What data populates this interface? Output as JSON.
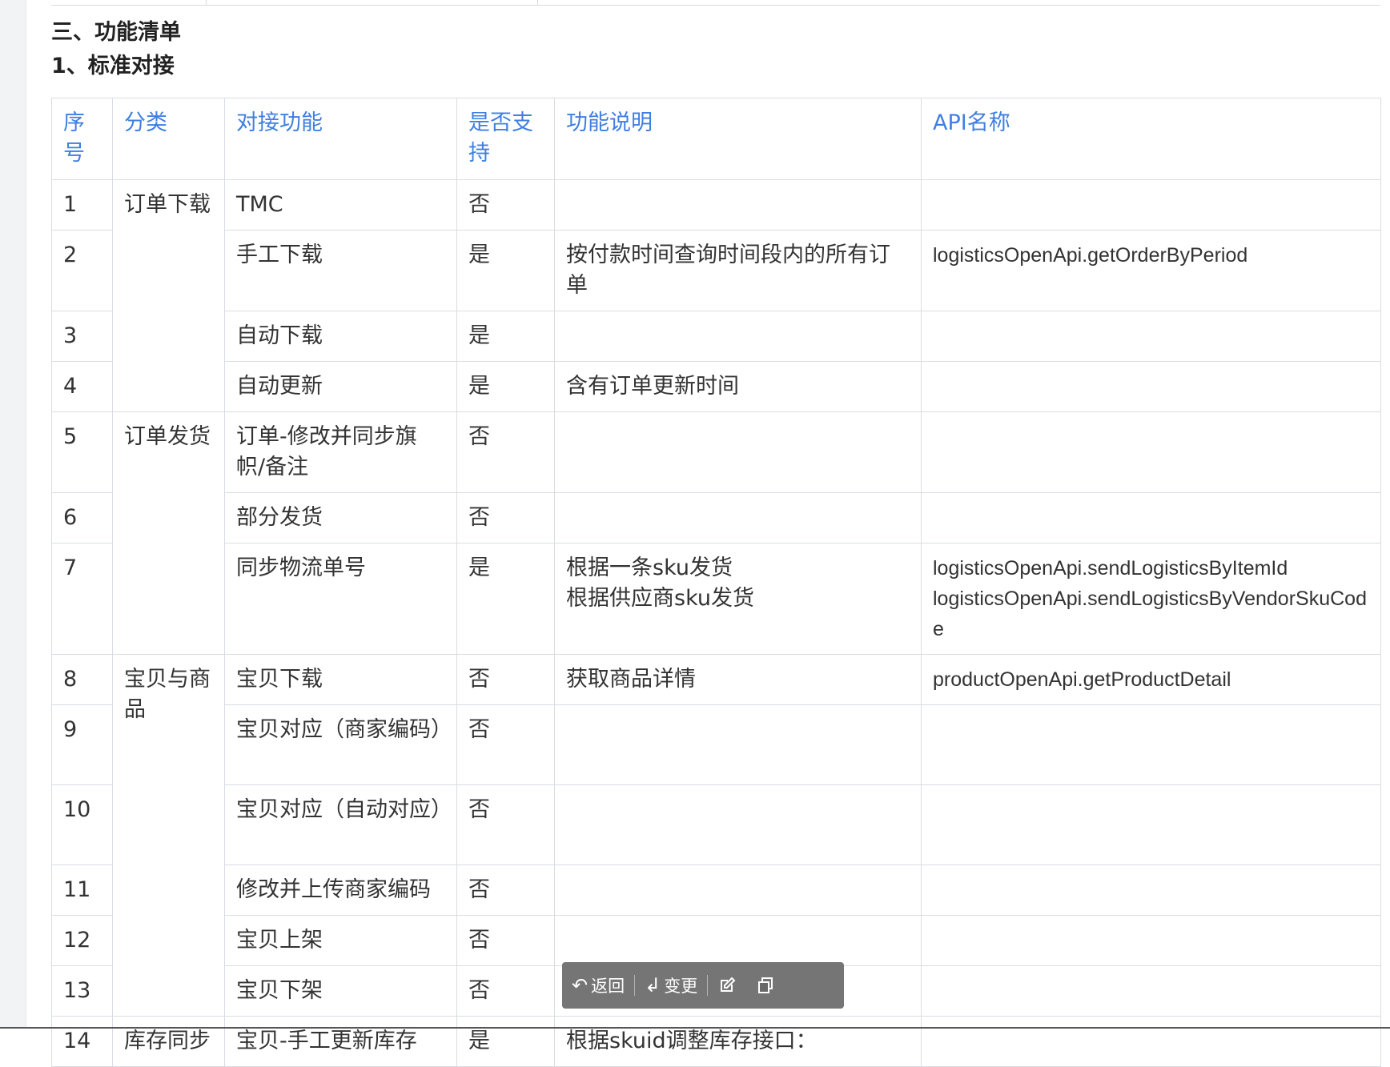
{
  "headings": {
    "section": "三、功能清单",
    "subsection": "1、标准对接"
  },
  "table": {
    "headers": [
      "序号",
      "分类",
      "对接功能",
      "是否支持",
      "功能说明",
      "API名称"
    ],
    "rows": [
      {
        "no": "1",
        "category": "订单下载",
        "feature": "TMC",
        "supported": "否",
        "desc": "",
        "api": ""
      },
      {
        "no": "2",
        "category": "",
        "feature": "手工下载",
        "supported": "是",
        "desc": "按付款时间查询时间段内的所有订单",
        "api": "logisticsOpenApi.getOrderByPeriod"
      },
      {
        "no": "3",
        "category": "",
        "feature": "自动下载",
        "supported": "是",
        "desc": "",
        "api": ""
      },
      {
        "no": "4",
        "category": "",
        "feature": "自动更新",
        "supported": "是",
        "desc": "含有订单更新时间",
        "api": ""
      },
      {
        "no": "5",
        "category": "订单发货",
        "feature": "订单-修改并同步旗帜/备注",
        "supported": "否",
        "desc": "",
        "api": ""
      },
      {
        "no": "6",
        "category": "",
        "feature": "部分发货",
        "supported": "否",
        "desc": "",
        "api": ""
      },
      {
        "no": "7",
        "category": "",
        "feature": "同步物流单号",
        "supported": "是",
        "desc": "根据一条sku发货\n根据供应商sku发货",
        "api": "logisticsOpenApi.sendLogisticsByItemId\nlogisticsOpenApi.sendLogisticsByVendorSkuCode"
      },
      {
        "no": "8",
        "category": "宝贝与商品",
        "feature": "宝贝下载",
        "supported": "否",
        "desc": "获取商品详情",
        "api": "productOpenApi.getProductDetail"
      },
      {
        "no": "9",
        "category": "",
        "feature": "宝贝对应（商家编码）",
        "supported": "否",
        "desc": "",
        "api": ""
      },
      {
        "no": "10",
        "category": "",
        "feature": "宝贝对应（自动对应）",
        "supported": "否",
        "desc": "",
        "api": ""
      },
      {
        "no": "11",
        "category": "",
        "feature": "修改并上传商家编码",
        "supported": "否",
        "desc": "",
        "api": ""
      },
      {
        "no": "12",
        "category": "",
        "feature": "宝贝上架",
        "supported": "否",
        "desc": "",
        "api": ""
      },
      {
        "no": "13",
        "category": "",
        "feature": "宝贝下架",
        "supported": "否",
        "desc": "",
        "api": ""
      },
      {
        "no": "14",
        "category": "库存同步",
        "feature": "宝贝-手工更新库存",
        "supported": "是",
        "desc": "根据skuid调整库存接口：",
        "api": ""
      }
    ]
  },
  "toolbar": {
    "back_label": "返回",
    "change_label": "变更",
    "edit_icon": "edit-icon",
    "copy_icon": "copy-icon"
  },
  "colors": {
    "header_text": "#3f7fe0",
    "border": "#d9dde3",
    "toolbar_bg": "#696969"
  }
}
